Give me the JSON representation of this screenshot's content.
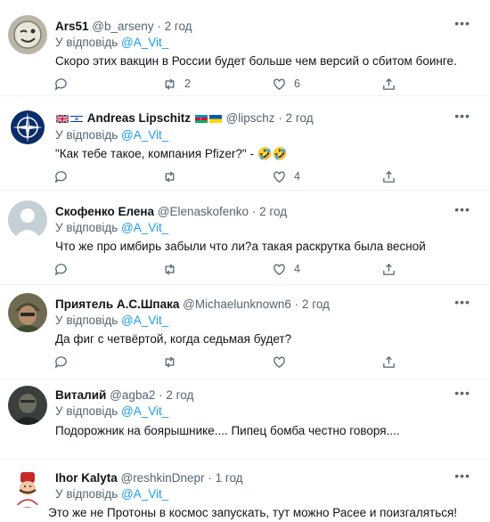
{
  "reply_prefix": "У відповідь",
  "tweets": [
    {
      "name": "Ars51",
      "handle": "@b_arseny",
      "time": "2 год",
      "reply_to": "@A_Vit_",
      "text": "Скоро этих вакцин в России будет больше чем версий о сбитом боинге.",
      "retweets": "2",
      "likes": "6",
      "avatar_icon": "winking-face-avatar"
    },
    {
      "name": "Andreas Lipschitz",
      "handle": "@lipschz",
      "time": "2 год",
      "reply_to": "@A_Vit_",
      "text": "\"Как тебе такое, компания Pfizer?\" - 🤣🤣",
      "retweets": "",
      "likes": "4",
      "avatar_icon": "nato-emblem-avatar",
      "name_prefix_flags": [
        "uk-flag",
        "israel-flag"
      ],
      "name_suffix_flags": [
        "azerbaijan-flag",
        "ukraine-flag"
      ]
    },
    {
      "name": "Скофенко Елена",
      "handle": "@Elenaskofenko",
      "time": "2 год",
      "reply_to": "@A_Vit_",
      "text": "Что же про имбирь забыли что ли?а такая раскрутка была весной",
      "retweets": "",
      "likes": "4",
      "avatar_icon": "default-person-avatar"
    },
    {
      "name": "Приятель А.С.Шпака",
      "handle": "@Michaelunknown6",
      "time": "2 год",
      "reply_to": "@A_Vit_",
      "text": "Да фиг с четвёртой, когда седьмая будет?",
      "retweets": "",
      "likes": "",
      "avatar_icon": "soldier-avatar"
    },
    {
      "name": "Виталий",
      "handle": "@agba2",
      "time": "2 год",
      "reply_to": "@A_Vit_",
      "text": "Подорожник на боярышнике.... Пипец бомба честно говоря....",
      "retweets": "",
      "likes": "",
      "avatar_icon": "dark-photo-avatar"
    },
    {
      "name": "Ihor Kalyta",
      "handle": "@reshkinDnepr",
      "time": "1 год",
      "reply_to": "@A_Vit_",
      "text": "Это же не Протоны в космос запускать, тут можно Расее и поизгаляться!",
      "retweets": "",
      "likes": "",
      "avatar_icon": "cartoon-man-avatar"
    }
  ],
  "colors": {
    "accent": "#1d9bf0",
    "secondary_text": "#536471",
    "primary_text": "#0f1419",
    "divider": "#eff3f4"
  }
}
